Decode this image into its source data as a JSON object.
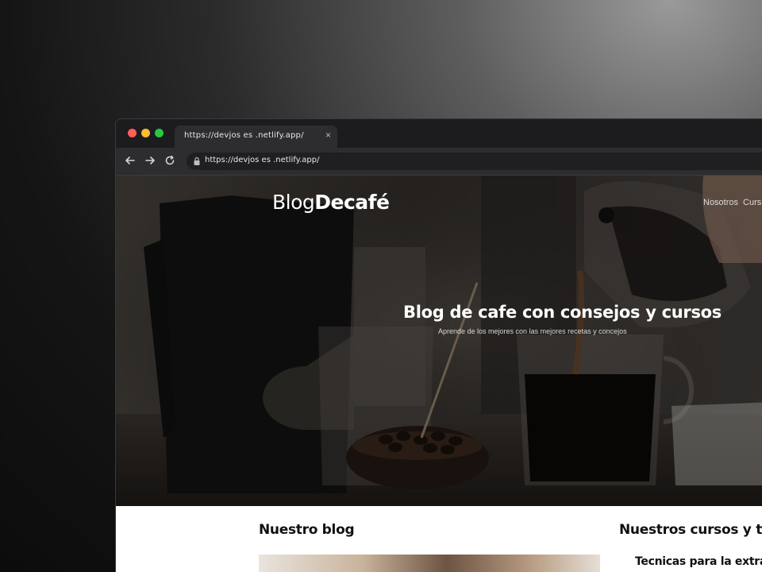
{
  "browser": {
    "tab_title": "https://devjos es .netlify.app/",
    "tab_close": "×",
    "url": "https://devjos es .netlify.app/"
  },
  "site": {
    "logo_light": "Blog",
    "logo_bold": "Decafé",
    "nav": [
      "Nosotros",
      "Curs"
    ],
    "hero_title": "Blog de cafe con consejos y cursos",
    "hero_subtitle": "Aprende de los mejores con las mejores recetas y concejos",
    "section_blog": "Nuestro blog",
    "section_courses": "Nuestros cursos y talle",
    "course_title": "Tecnicas para la extracc"
  },
  "colors": {
    "traffic_red": "#fe5f57",
    "traffic_yellow": "#febc2e",
    "traffic_green": "#28c840",
    "chrome_dark": "#1c1c1e",
    "chrome_toolbar": "#2d2d30"
  },
  "icons": [
    "back-arrow-icon",
    "forward-arrow-icon",
    "reload-icon",
    "lock-icon",
    "close-icon"
  ]
}
